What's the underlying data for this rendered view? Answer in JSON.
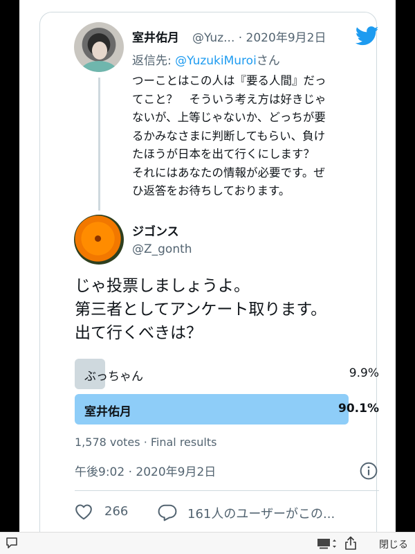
{
  "reply_tweet": {
    "name": "室井佑月",
    "handle_time": "@Yuz... · 2020年9月2日",
    "reply_to_prefix": "返信先: ",
    "reply_to_handle": "@YuzukiMuroi",
    "reply_to_suffix": "さん",
    "body_lines": [
      "つーことはこの人は『要る人間』だっ",
      "てこと？　そういう考え方は好きじゃ",
      "ないが、上等じゃないか、どっちが要",
      "るかみなさまに判断してもらい、負け",
      "たほうが日本を出て行くにします？",
      "それにはあなたの情報が必要です。ぜ",
      "ひ返答をお待ちしております。"
    ]
  },
  "main_tweet": {
    "name": "ジゴンス",
    "handle": "@Z_gonth",
    "text_lines": [
      "じゃ投票しましょうよ。",
      "第三者としてアンケート取ります。",
      "出て行くべきは？"
    ],
    "poll": {
      "options": [
        {
          "label": "ぶっちゃん",
          "percent": "9.9%",
          "fraction": 0.099
        },
        {
          "label": "室井佑月",
          "percent": "90.1%",
          "fraction": 0.901
        }
      ],
      "results_text": "1,578 votes · Final results"
    },
    "timestamp": "午後9:02 · 2020年9月2日",
    "like_count": "266",
    "reply_text": "161人のユーザーがこの..."
  },
  "bottom_bar": {
    "close_label": "閉じる"
  },
  "colors": {
    "twitter_blue": "#1d9bf0",
    "winner_bar": "#8ecdf8",
    "loser_bar": "#cfd9de"
  },
  "icons": [
    "twitter-bird-icon",
    "info-icon",
    "heart-icon",
    "reply-bubble-icon",
    "chat-icon",
    "screen-icon",
    "share-icon"
  ]
}
